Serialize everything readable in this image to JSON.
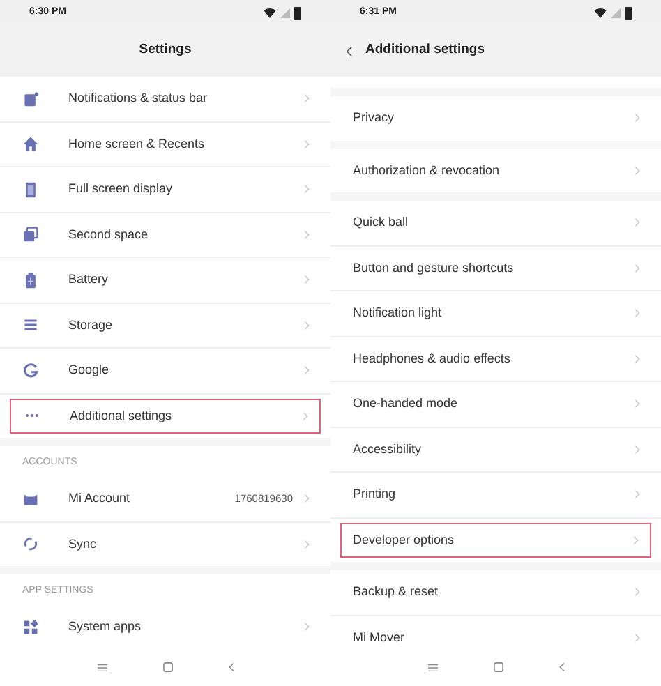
{
  "screens": [
    {
      "status_bar": {
        "time": "6:30 PM"
      },
      "header": {
        "title": "Settings",
        "back": false
      },
      "groups": [
        {
          "rows": [
            {
              "label": "Notifications & status bar",
              "highlighted": false
            },
            {
              "label": "Home screen & Recents",
              "highlighted": false
            },
            {
              "label": "Full screen display",
              "highlighted": false
            },
            {
              "label": "Second space",
              "highlighted": false
            },
            {
              "label": "Battery",
              "highlighted": false
            },
            {
              "label": "Storage",
              "highlighted": false
            },
            {
              "label": "Google",
              "highlighted": false
            },
            {
              "label": "Additional settings",
              "highlighted": true
            }
          ]
        },
        {
          "header": "ACCOUNTS",
          "rows": [
            {
              "label": "Mi Account",
              "value": "1760819630",
              "highlighted": false
            },
            {
              "label": "Sync",
              "highlighted": false
            }
          ]
        },
        {
          "header": "APP SETTINGS",
          "rows": [
            {
              "label": "System apps",
              "highlighted": false
            }
          ]
        }
      ]
    },
    {
      "status_bar": {
        "time": "6:31 PM"
      },
      "header": {
        "title": "Additional settings",
        "back": true
      },
      "groups": [
        {
          "rows": [
            {
              "label": "Privacy",
              "highlighted": false
            }
          ]
        },
        {
          "rows": [
            {
              "label": "Authorization & revocation",
              "highlighted": false
            }
          ]
        },
        {
          "rows": [
            {
              "label": "Quick ball",
              "highlighted": false
            },
            {
              "label": "Button and gesture shortcuts",
              "highlighted": false
            },
            {
              "label": "Notification light",
              "highlighted": false
            },
            {
              "label": "Headphones & audio effects",
              "highlighted": false
            },
            {
              "label": "One-handed mode",
              "highlighted": false
            },
            {
              "label": "Accessibility",
              "highlighted": false
            },
            {
              "label": "Printing",
              "highlighted": false
            },
            {
              "label": "Developer options",
              "highlighted": true
            }
          ]
        },
        {
          "rows": [
            {
              "label": "Backup & reset",
              "highlighted": false
            },
            {
              "label": "Mi Mover",
              "highlighted": false
            }
          ]
        }
      ]
    }
  ]
}
